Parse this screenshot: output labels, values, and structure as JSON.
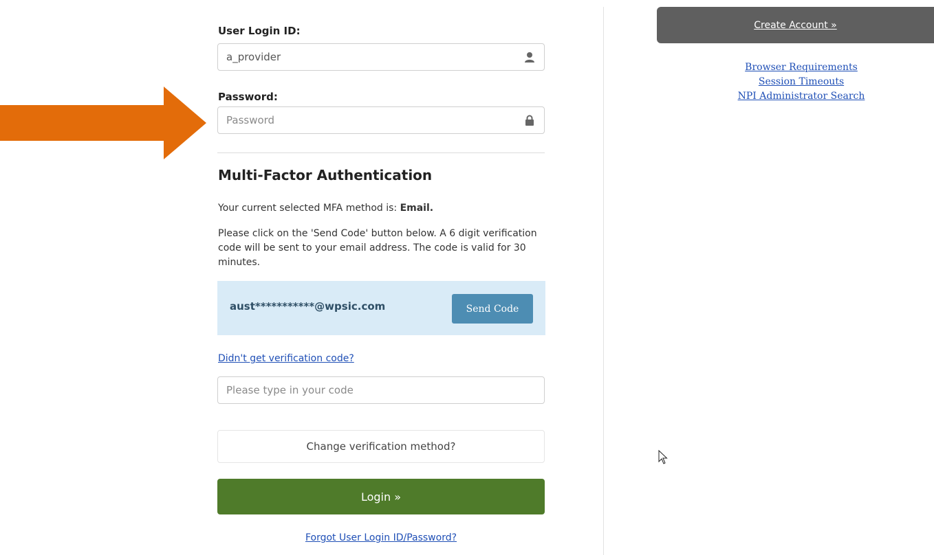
{
  "login": {
    "user_id_label": "User Login ID:",
    "user_id_value": "a_provider",
    "password_label": "Password:",
    "password_placeholder": "Password"
  },
  "mfa": {
    "heading": "Multi-Factor Authentication",
    "method_text": "Your current selected MFA method is: ",
    "method_value": "Email.",
    "instructions": "Please click on the 'Send Code' button below. A 6 digit verification code will be sent to your email address. The code is valid for 30 minutes.",
    "masked_email": "aust***********@wpsic.com",
    "send_code_label": "Send Code",
    "didnt_get_link": "Didn't get verification code?",
    "code_placeholder": "Please type in your code",
    "change_method_label": "Change verification method?"
  },
  "actions": {
    "login_label": "Login »",
    "forgot_link": "Forgot User Login ID/Password?"
  },
  "sidebar": {
    "create_account_label": "Create Account »",
    "links": [
      "Browser Requirements",
      "Session Timeouts",
      "NPI Administrator Search"
    ]
  },
  "icons": {
    "user": "user-icon",
    "lock": "lock-icon",
    "annotation_arrow": "arrow-right-icon",
    "cursor": "mouse-cursor-icon"
  },
  "colors": {
    "arrow": "#e36c0a",
    "login_button": "#4f7b2a",
    "send_code_button": "#4d8db3",
    "mfa_box": "#d9ebf7",
    "create_account_button": "#5f5f5f",
    "link": "#1f4fb6"
  }
}
